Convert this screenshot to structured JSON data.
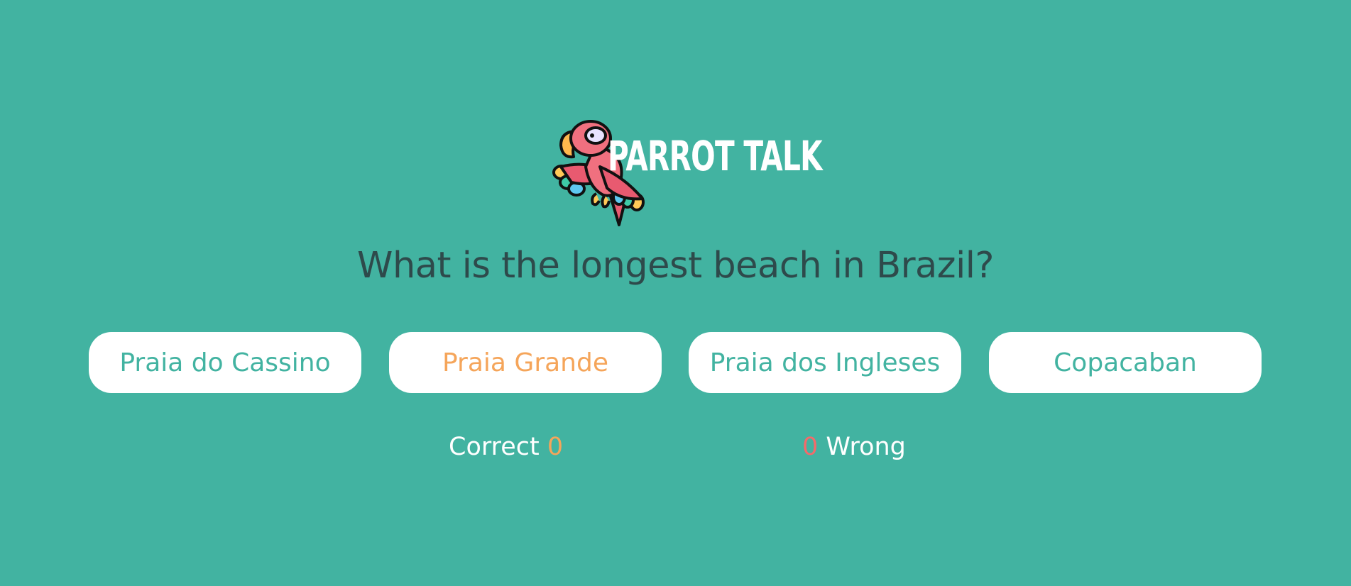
{
  "brand": {
    "title": "PARROT TALK",
    "logo_icon": "parrot-icon"
  },
  "question": "What is the longest beach in Brazil?",
  "answers": [
    {
      "label": "Praia do Cassino",
      "highlighted": false
    },
    {
      "label": "Praia Grande",
      "highlighted": true
    },
    {
      "label": "Praia dos Ingleses",
      "highlighted": false
    },
    {
      "label": "Copacaban",
      "highlighted": false
    }
  ],
  "score": {
    "correct_label": "Correct",
    "correct_count": "0",
    "wrong_count": "0",
    "wrong_label": "Wrong"
  },
  "colors": {
    "background": "#42b3a1",
    "question_text": "#2e4a4b",
    "answer_text": "#42b3a1",
    "highlight": "#f5a55a",
    "wrong": "#f46a6a"
  }
}
